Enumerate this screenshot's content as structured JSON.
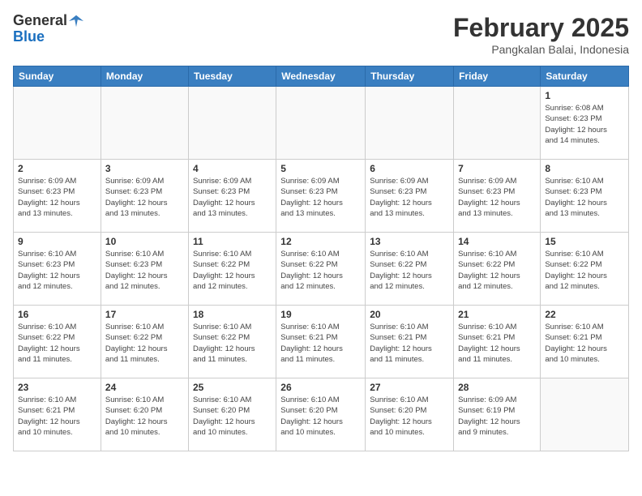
{
  "header": {
    "logo_general": "General",
    "logo_blue": "Blue",
    "month_title": "February 2025",
    "location": "Pangkalan Balai, Indonesia"
  },
  "weekdays": [
    "Sunday",
    "Monday",
    "Tuesday",
    "Wednesday",
    "Thursday",
    "Friday",
    "Saturday"
  ],
  "weeks": [
    [
      {
        "day": "",
        "info": ""
      },
      {
        "day": "",
        "info": ""
      },
      {
        "day": "",
        "info": ""
      },
      {
        "day": "",
        "info": ""
      },
      {
        "day": "",
        "info": ""
      },
      {
        "day": "",
        "info": ""
      },
      {
        "day": "1",
        "info": "Sunrise: 6:08 AM\nSunset: 6:23 PM\nDaylight: 12 hours\nand 14 minutes."
      }
    ],
    [
      {
        "day": "2",
        "info": "Sunrise: 6:09 AM\nSunset: 6:23 PM\nDaylight: 12 hours\nand 13 minutes."
      },
      {
        "day": "3",
        "info": "Sunrise: 6:09 AM\nSunset: 6:23 PM\nDaylight: 12 hours\nand 13 minutes."
      },
      {
        "day": "4",
        "info": "Sunrise: 6:09 AM\nSunset: 6:23 PM\nDaylight: 12 hours\nand 13 minutes."
      },
      {
        "day": "5",
        "info": "Sunrise: 6:09 AM\nSunset: 6:23 PM\nDaylight: 12 hours\nand 13 minutes."
      },
      {
        "day": "6",
        "info": "Sunrise: 6:09 AM\nSunset: 6:23 PM\nDaylight: 12 hours\nand 13 minutes."
      },
      {
        "day": "7",
        "info": "Sunrise: 6:09 AM\nSunset: 6:23 PM\nDaylight: 12 hours\nand 13 minutes."
      },
      {
        "day": "8",
        "info": "Sunrise: 6:10 AM\nSunset: 6:23 PM\nDaylight: 12 hours\nand 13 minutes."
      }
    ],
    [
      {
        "day": "9",
        "info": "Sunrise: 6:10 AM\nSunset: 6:23 PM\nDaylight: 12 hours\nand 12 minutes."
      },
      {
        "day": "10",
        "info": "Sunrise: 6:10 AM\nSunset: 6:23 PM\nDaylight: 12 hours\nand 12 minutes."
      },
      {
        "day": "11",
        "info": "Sunrise: 6:10 AM\nSunset: 6:22 PM\nDaylight: 12 hours\nand 12 minutes."
      },
      {
        "day": "12",
        "info": "Sunrise: 6:10 AM\nSunset: 6:22 PM\nDaylight: 12 hours\nand 12 minutes."
      },
      {
        "day": "13",
        "info": "Sunrise: 6:10 AM\nSunset: 6:22 PM\nDaylight: 12 hours\nand 12 minutes."
      },
      {
        "day": "14",
        "info": "Sunrise: 6:10 AM\nSunset: 6:22 PM\nDaylight: 12 hours\nand 12 minutes."
      },
      {
        "day": "15",
        "info": "Sunrise: 6:10 AM\nSunset: 6:22 PM\nDaylight: 12 hours\nand 12 minutes."
      }
    ],
    [
      {
        "day": "16",
        "info": "Sunrise: 6:10 AM\nSunset: 6:22 PM\nDaylight: 12 hours\nand 11 minutes."
      },
      {
        "day": "17",
        "info": "Sunrise: 6:10 AM\nSunset: 6:22 PM\nDaylight: 12 hours\nand 11 minutes."
      },
      {
        "day": "18",
        "info": "Sunrise: 6:10 AM\nSunset: 6:22 PM\nDaylight: 12 hours\nand 11 minutes."
      },
      {
        "day": "19",
        "info": "Sunrise: 6:10 AM\nSunset: 6:21 PM\nDaylight: 12 hours\nand 11 minutes."
      },
      {
        "day": "20",
        "info": "Sunrise: 6:10 AM\nSunset: 6:21 PM\nDaylight: 12 hours\nand 11 minutes."
      },
      {
        "day": "21",
        "info": "Sunrise: 6:10 AM\nSunset: 6:21 PM\nDaylight: 12 hours\nand 11 minutes."
      },
      {
        "day": "22",
        "info": "Sunrise: 6:10 AM\nSunset: 6:21 PM\nDaylight: 12 hours\nand 10 minutes."
      }
    ],
    [
      {
        "day": "23",
        "info": "Sunrise: 6:10 AM\nSunset: 6:21 PM\nDaylight: 12 hours\nand 10 minutes."
      },
      {
        "day": "24",
        "info": "Sunrise: 6:10 AM\nSunset: 6:20 PM\nDaylight: 12 hours\nand 10 minutes."
      },
      {
        "day": "25",
        "info": "Sunrise: 6:10 AM\nSunset: 6:20 PM\nDaylight: 12 hours\nand 10 minutes."
      },
      {
        "day": "26",
        "info": "Sunrise: 6:10 AM\nSunset: 6:20 PM\nDaylight: 12 hours\nand 10 minutes."
      },
      {
        "day": "27",
        "info": "Sunrise: 6:10 AM\nSunset: 6:20 PM\nDaylight: 12 hours\nand 10 minutes."
      },
      {
        "day": "28",
        "info": "Sunrise: 6:09 AM\nSunset: 6:19 PM\nDaylight: 12 hours\nand 9 minutes."
      },
      {
        "day": "",
        "info": ""
      }
    ]
  ]
}
